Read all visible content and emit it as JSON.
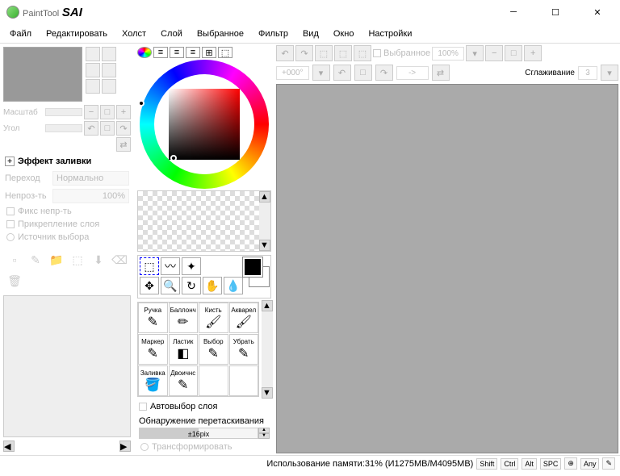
{
  "title": {
    "pt": "PaintTool",
    "sai": "SAI"
  },
  "menu": [
    "Файл",
    "Редактировать",
    "Холст",
    "Слой",
    "Выбранное",
    "Фильтр",
    "Вид",
    "Окно",
    "Настройки"
  ],
  "nav": {
    "scale_label": "Масштаб",
    "angle_label": "Угол"
  },
  "fill_effect": {
    "title": "Эффект заливки",
    "mode_label": "Переход",
    "mode_value": "Нормально",
    "opacity_label": "Непроз-ть",
    "opacity_value": "100%"
  },
  "layer_opts": {
    "fix": "Фикс непр-ть",
    "clip": "Прикрепление слоя",
    "src": "Источник выбора"
  },
  "brushes": [
    "Ручка",
    "Баллонч",
    "Кисть",
    "Акварел",
    "Маркер",
    "Ластик",
    "Выбор",
    "Убрать",
    "Заливка",
    "Двоичнс"
  ],
  "auto_select": "Автовыбор слоя",
  "drag": {
    "label": "Обнаружение перетаскивания",
    "value": "±16pix"
  },
  "transform": "Трансформировать",
  "canvas": {
    "selected": "Выбранное",
    "zoom": "100%",
    "angle": "+000°",
    "arrow": "->",
    "smooth_label": "Сглаживание",
    "smooth_value": "3"
  },
  "status": {
    "mem": "Использование памяти:31% (И1275MB/M4095MB)",
    "keys": [
      "Shift",
      "Ctrl",
      "Alt",
      "SPC",
      "⊕",
      "Any",
      "✎"
    ]
  }
}
